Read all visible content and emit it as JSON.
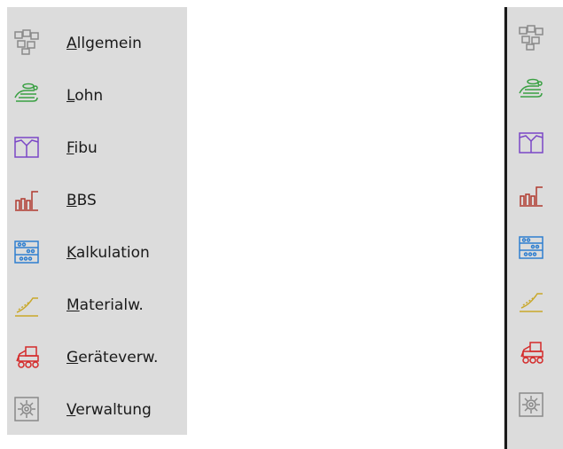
{
  "nav": {
    "items": [
      {
        "label": "Allgemein",
        "icon": "network-boxes-icon",
        "color": "#8a8a8a"
      },
      {
        "label": "Lohn",
        "icon": "hand-coins-icon",
        "color": "#3aa043"
      },
      {
        "label": "Fibu",
        "icon": "ledger-icon",
        "color": "#7b47c7"
      },
      {
        "label": "BBS",
        "icon": "bar-chart-icon",
        "color": "#b03a2e"
      },
      {
        "label": "Kalkulation",
        "icon": "abacus-icon",
        "color": "#2f7fd0"
      },
      {
        "label": "Materialw.",
        "icon": "ramp-icon",
        "color": "#c9a82a"
      },
      {
        "label": "Geräteverw.",
        "icon": "excavator-icon",
        "color": "#d42a2a"
      },
      {
        "label": "Verwaltung",
        "icon": "gear-icon",
        "color": "#8a8a8a"
      }
    ]
  }
}
